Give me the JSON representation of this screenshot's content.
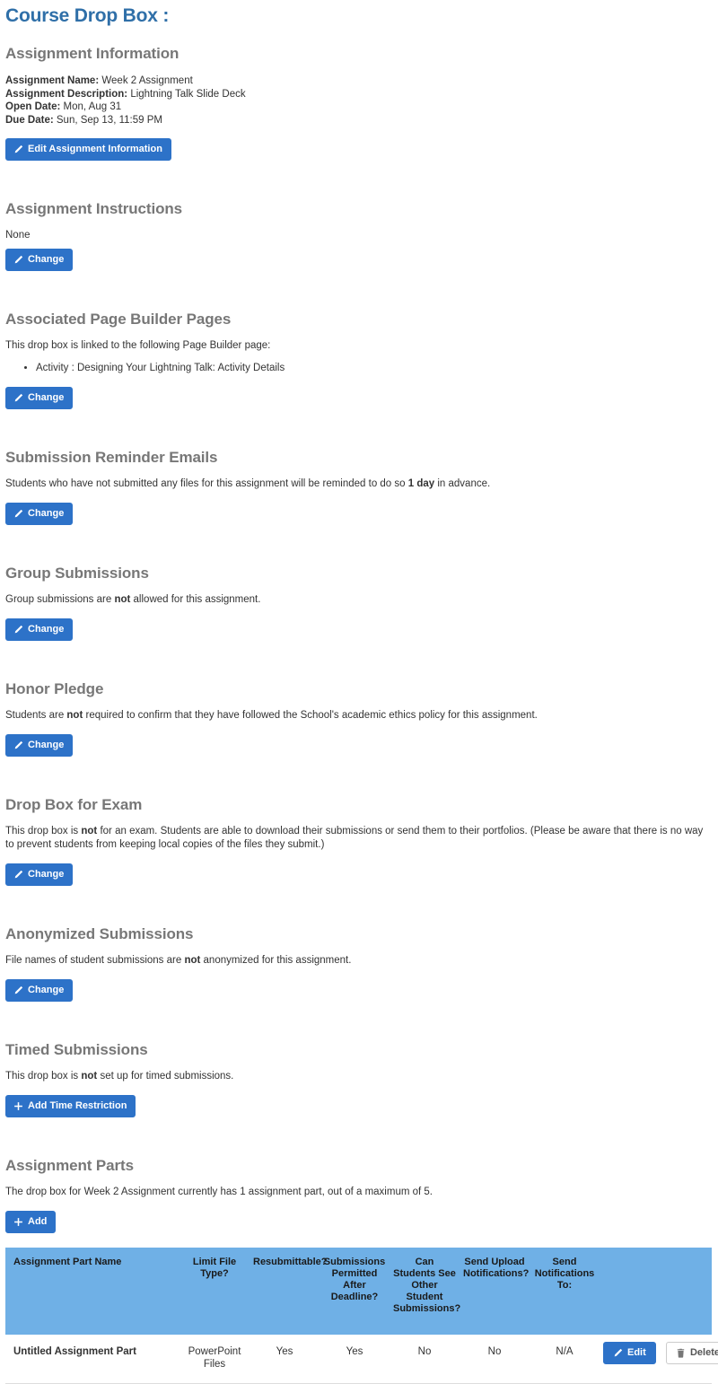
{
  "page": {
    "title": "Course Drop Box :"
  },
  "sections": {
    "assignment_information": {
      "heading": "Assignment Information",
      "fields": [
        {
          "label": "Assignment Name:",
          "value": "Week 2 Assignment"
        },
        {
          "label": "Assignment Description:",
          "value": "Lightning Talk Slide Deck"
        },
        {
          "label": "Open Date:",
          "value": "Mon, Aug 31"
        },
        {
          "label": "Due Date:",
          "value": "Sun, Sep 13, 11:59 PM"
        }
      ],
      "button": "Edit Assignment Information"
    },
    "assignment_instructions": {
      "heading": "Assignment Instructions",
      "text": "None",
      "button": "Change"
    },
    "associated_pages": {
      "heading": "Associated Page Builder Pages",
      "text": "This drop box is linked to the following Page Builder page:",
      "items": [
        "Activity : Designing Your Lightning Talk: Activity Details"
      ],
      "button": "Change"
    },
    "reminder_emails": {
      "heading": "Submission Reminder Emails",
      "text_before": "Students who have not submitted any files for this assignment will be reminded to do so ",
      "text_bold": "1 day",
      "text_after": " in advance.",
      "button": "Change"
    },
    "group_submissions": {
      "heading": "Group Submissions",
      "text_before": "Group submissions are ",
      "text_bold": "not",
      "text_after": " allowed for this assignment.",
      "button": "Change"
    },
    "honor_pledge": {
      "heading": "Honor Pledge",
      "text_before": "Students are ",
      "text_bold": "not",
      "text_after": " required to confirm that they have followed the School's academic ethics policy for this assignment.",
      "button": "Change"
    },
    "drop_box_for_exam": {
      "heading": "Drop Box for Exam",
      "text_before": "This drop box is ",
      "text_bold": "not",
      "text_after": " for an exam. Students are able to download their submissions or send them to their portfolios. (Please be aware that there is no way to prevent students from keeping local copies of the files they submit.)",
      "button": "Change"
    },
    "anonymized_submissions": {
      "heading": "Anonymized Submissions",
      "text_before": "File names of student submissions are ",
      "text_bold": "not",
      "text_after": " anonymized for this assignment.",
      "button": "Change"
    },
    "timed_submissions": {
      "heading": "Timed Submissions",
      "text_before": "This drop box is ",
      "text_bold": "not",
      "text_after": " set up for timed submissions.",
      "button": "Add Time Restriction"
    },
    "assignment_parts": {
      "heading": "Assignment Parts",
      "text": "The drop box for Week 2 Assignment currently has 1 assignment part, out of a maximum of 5.",
      "button": "Add",
      "table": {
        "columns": [
          "Assignment Part Name",
          "Limit File Type?",
          "Resubmittable?",
          "Submissions Permitted After Deadline?",
          "Can Students See Other Student Submissions?",
          "Send Upload Notifications?",
          "Send Notifications To:",
          ""
        ],
        "rows": [
          {
            "name": "Untitled Assignment Part",
            "limit_file_type": "PowerPoint Files",
            "resubmittable": "Yes",
            "submissions_after_deadline": "Yes",
            "students_see_other": "No",
            "send_upload_notifications": "No",
            "send_notifications_to": "N/A",
            "edit_label": "Edit",
            "delete_label": "Delete"
          }
        ]
      }
    }
  },
  "colors": {
    "title_blue": "#2f6fa8",
    "heading_gray": "#777777",
    "button_blue": "#2d72c8",
    "table_header_blue": "#6fb0e6",
    "body_text": "#333333"
  }
}
